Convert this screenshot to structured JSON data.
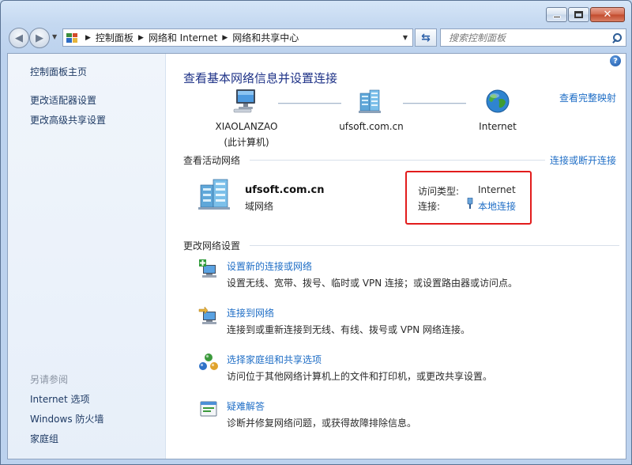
{
  "breadcrumbs": [
    "控制面板",
    "网络和 Internet",
    "网络和共享中心"
  ],
  "search": {
    "placeholder": "搜索控制面板"
  },
  "sidebar": {
    "items": [
      {
        "label": "控制面板主页"
      },
      {
        "label": "更改适配器设置"
      },
      {
        "label": "更改高级共享设置"
      }
    ],
    "see_also_heading": "另请参阅",
    "see_also": [
      {
        "label": "Internet 选项"
      },
      {
        "label": "Windows 防火墙"
      },
      {
        "label": "家庭组"
      }
    ]
  },
  "main": {
    "title": "查看基本网络信息并设置连接",
    "full_map_link": "查看完整映射",
    "map": {
      "computer_name": "XIAOLANZAO",
      "computer_sub": "(此计算机)",
      "domain_node": "ufsoft.com.cn",
      "internet_node": "Internet"
    },
    "active_networks": {
      "heading": "查看活动网络",
      "connect_link": "连接或断开连接",
      "network_name": "ufsoft.com.cn",
      "network_type": "域网络",
      "access_type_label": "访问类型:",
      "access_type_value": "Internet",
      "connection_label": "连接:",
      "connection_value": "本地连接"
    },
    "change_settings": {
      "heading": "更改网络设置",
      "tasks": [
        {
          "title": "设置新的连接或网络",
          "desc": "设置无线、宽带、拨号、临时或 VPN 连接；或设置路由器或访问点。",
          "icon": "new-connection-icon"
        },
        {
          "title": "连接到网络",
          "desc": "连接到或重新连接到无线、有线、拨号或 VPN 网络连接。",
          "icon": "connect-network-icon"
        },
        {
          "title": "选择家庭组和共享选项",
          "desc": "访问位于其他网络计算机上的文件和打印机，或更改共享设置。",
          "icon": "homegroup-icon"
        },
        {
          "title": "疑难解答",
          "desc": "诊断并修复网络问题，或获得故障排除信息。",
          "icon": "troubleshoot-icon"
        }
      ]
    }
  },
  "colors": {
    "link": "#1f6ec6",
    "title": "#1e3287",
    "highlight": "#e21c1c"
  }
}
